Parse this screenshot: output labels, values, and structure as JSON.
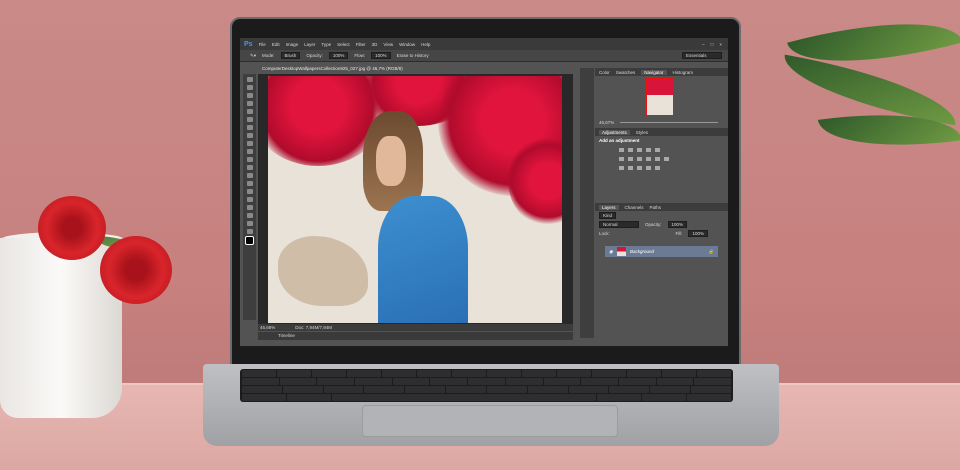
{
  "app": {
    "logo": "Ps",
    "menu": [
      "File",
      "Edit",
      "Image",
      "Layer",
      "Type",
      "Select",
      "Filter",
      "3D",
      "View",
      "Window",
      "Help"
    ]
  },
  "options_bar": {
    "mode_label": "Mode:",
    "mode_value": "Brush",
    "opacity_label": "Opacity:",
    "opacity_value": "100%",
    "flow_label": "Flow:",
    "flow_value": "100%",
    "erase_history": "Erase to History",
    "workspace": "Essentials"
  },
  "document": {
    "tab_title": "ComputerDesktopWallpapersCollection925_027.jpg @ 46,7% (RGB/8)",
    "zoom": "46,68%",
    "doc_size": "Doc: 7,94M/7,94M",
    "timeline": "Timeline"
  },
  "panels": {
    "top_tabs": [
      "Color",
      "Swatches",
      "Navigator",
      "Histogram"
    ],
    "navigator_zoom": "46,67%",
    "adjust_tabs": [
      "Adjustments",
      "Styles"
    ],
    "add_adjustment": "Add an adjustment",
    "layer_tabs": [
      "Layers",
      "Channels",
      "Paths"
    ],
    "kind": "Kind",
    "blend_mode": "Normal",
    "opacity_label": "Opacity:",
    "opacity_value": "100%",
    "lock_label": "Lock:",
    "fill_label": "Fill:",
    "fill_value": "100%",
    "layer_name": "Background"
  }
}
